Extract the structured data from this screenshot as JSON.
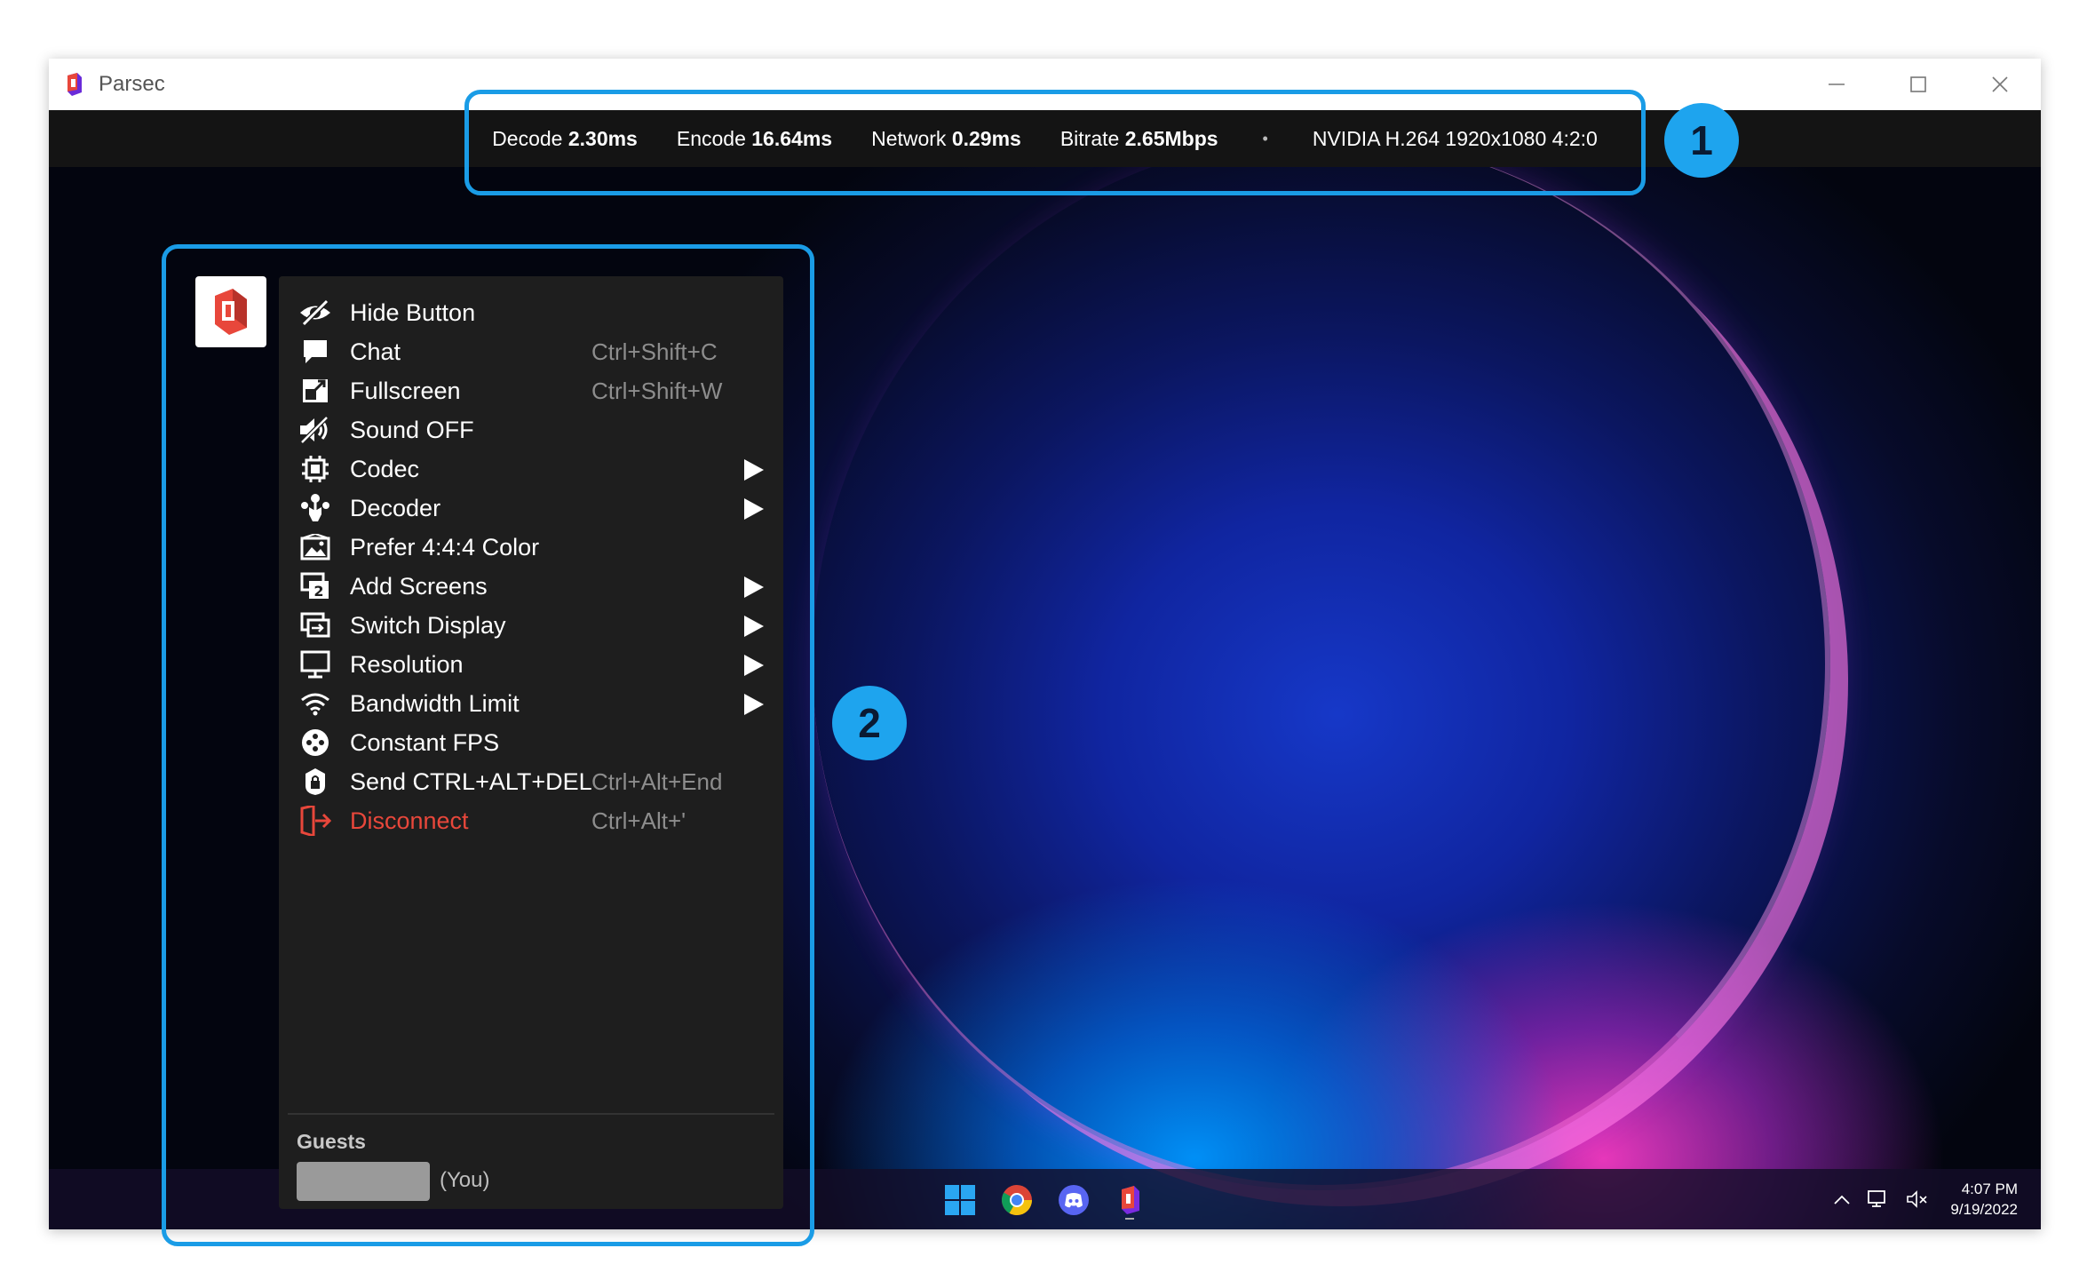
{
  "window": {
    "title": "Parsec"
  },
  "stats": {
    "decode_label": "Decode",
    "decode_value": "2.30ms",
    "encode_label": "Encode",
    "encode_value": "16.64ms",
    "network_label": "Network",
    "network_value": "0.29ms",
    "bitrate_label": "Bitrate",
    "bitrate_value": "2.65Mbps",
    "separator": "•",
    "codec_info": "NVIDIA H.264 1920x1080 4:2:0"
  },
  "menu": {
    "items": [
      {
        "label": "Hide Button",
        "shortcut": "",
        "icon": "eye-slash-icon"
      },
      {
        "label": "Chat",
        "shortcut": "Ctrl+Shift+C",
        "icon": "chat-icon"
      },
      {
        "label": "Fullscreen",
        "shortcut": "Ctrl+Shift+W",
        "icon": "fullscreen-icon"
      },
      {
        "label": "Sound OFF",
        "shortcut": "",
        "icon": "sound-off-icon"
      },
      {
        "label": "Codec",
        "shortcut": "",
        "icon": "chip-icon",
        "submenu": true
      },
      {
        "label": "Decoder",
        "shortcut": "",
        "icon": "decoder-icon",
        "submenu": true
      },
      {
        "label": "Prefer 4:4:4 Color",
        "shortcut": "",
        "icon": "image-icon"
      },
      {
        "label": "Add Screens",
        "shortcut": "",
        "icon": "add-screens-icon",
        "submenu": true
      },
      {
        "label": "Switch Display",
        "shortcut": "",
        "icon": "switch-display-icon",
        "submenu": true
      },
      {
        "label": "Resolution",
        "shortcut": "",
        "icon": "monitor-icon",
        "submenu": true
      },
      {
        "label": "Bandwidth Limit",
        "shortcut": "",
        "icon": "wifi-icon",
        "submenu": true
      },
      {
        "label": "Constant FPS",
        "shortcut": "",
        "icon": "gamepad-icon"
      },
      {
        "label": "Send CTRL+ALT+DEL",
        "shortcut": "Ctrl+Alt+End",
        "icon": "lock-icon"
      },
      {
        "label": "Disconnect",
        "shortcut": "Ctrl+Alt+'",
        "icon": "disconnect-icon"
      }
    ],
    "guests_title": "Guests",
    "guest_you": "(You)"
  },
  "taskbar": {
    "time": "4:07 PM",
    "date": "9/19/2022"
  },
  "badges": {
    "one": "1",
    "two": "2"
  },
  "colors": {
    "accent": "#1ea4ee",
    "danger": "#e8473b",
    "menu_bg": "#1e1e1e",
    "parsec_red": "#e8473b"
  }
}
